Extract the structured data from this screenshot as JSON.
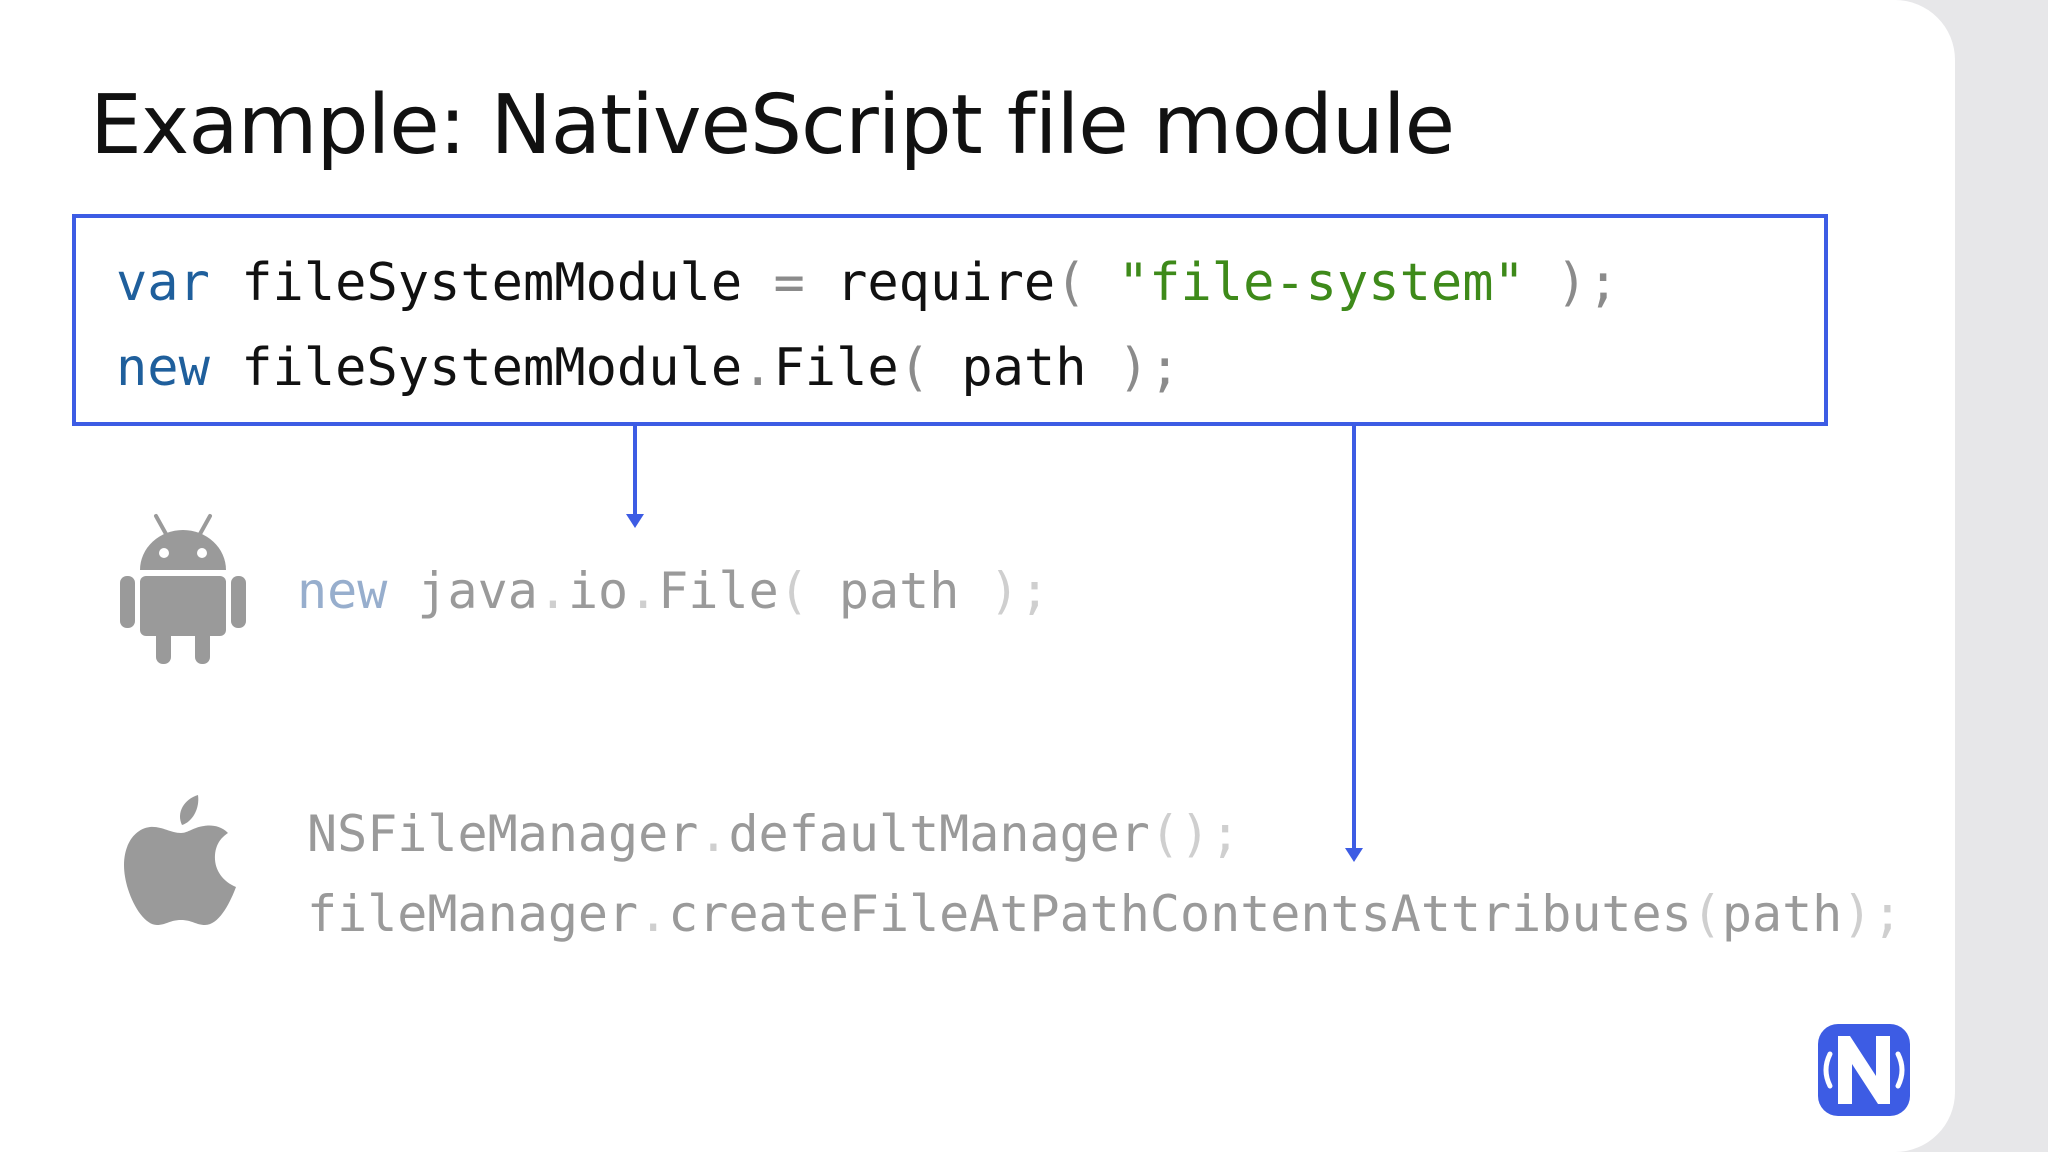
{
  "slide": {
    "title": "Example: NativeScript file module"
  },
  "main_code": {
    "line1": {
      "kw": "var",
      "ident": " fileSystemModule ",
      "op": "=",
      "call": " require",
      "open": "( ",
      "str": "\"file-system\"",
      "close": " );"
    },
    "line2": {
      "kw": "new",
      "obj": " fileSystemModule",
      "dot": ".",
      "method": "File",
      "open": "( ",
      "arg": "path",
      "close": " );"
    }
  },
  "android_code": {
    "kw": "new",
    "pkg1": " java",
    "dot1": ".",
    "pkg2": "io",
    "dot2": ".",
    "cls": "File",
    "open": "( ",
    "arg": "path",
    "close": " );"
  },
  "ios_code": {
    "line1": {
      "obj": "NSFileManager",
      "dot": ".",
      "method": "defaultManager",
      "close": "();"
    },
    "line2": {
      "obj": "fileManager",
      "dot": ".",
      "method": "createFileAtPathContentsAttributes",
      "open": "(",
      "arg": "path",
      "close": ");"
    }
  },
  "icons": {
    "android": "android-icon",
    "apple": "apple-icon",
    "logo": "nativescript-logo-icon"
  },
  "colors": {
    "accent": "#3d5ce4",
    "keyword": "#1f5f9c",
    "string": "#3e8a1a"
  }
}
